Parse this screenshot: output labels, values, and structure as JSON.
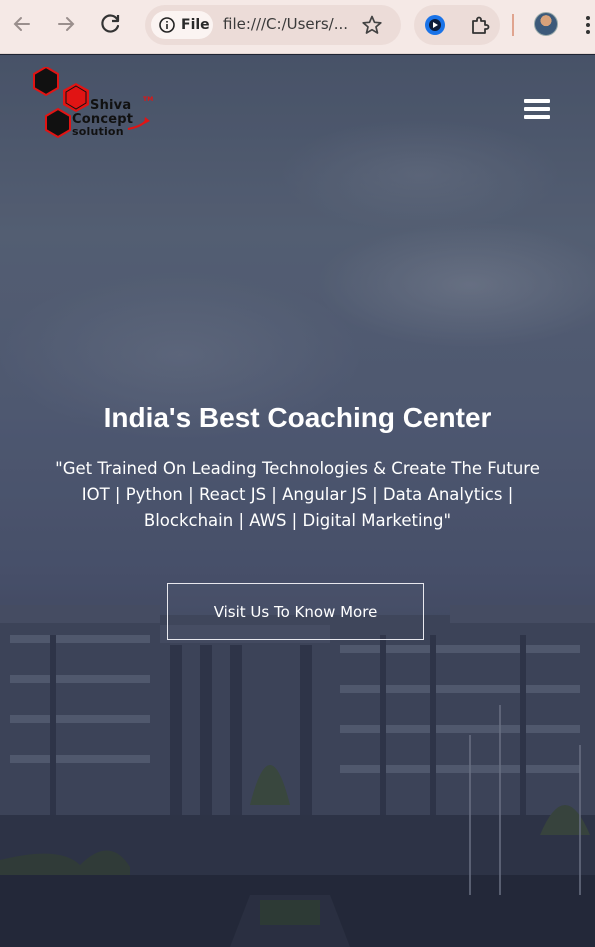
{
  "browser": {
    "back_icon": "arrow-left-icon",
    "forward_icon": "arrow-right-icon",
    "reload_icon": "reload-icon",
    "site_info_label": "File",
    "url": "file:///C:/Users/...",
    "bookmark_icon": "star-icon",
    "extension_icon": "puzzle-icon",
    "menu_icon": "kebab-icon"
  },
  "site": {
    "logo": {
      "line1": "Shiva",
      "tm": "TM",
      "line2": "Concept",
      "line3": "solution"
    },
    "nav_toggle": "hamburger-icon"
  },
  "hero": {
    "title": "India's Best Coaching Center",
    "subtitle_line1": "\"Get Trained On Leading Technologies & Create The Future",
    "subtitle_line2": "IOT | Python | React JS | Angular JS | Data Analytics |",
    "subtitle_line3": "Blockchain | AWS | Digital Marketing\"",
    "cta_label": "Visit Us To Know More"
  },
  "colors": {
    "accent_red": "#e11414",
    "logo_dark": "#111111",
    "hero_text": "#ffffff"
  }
}
